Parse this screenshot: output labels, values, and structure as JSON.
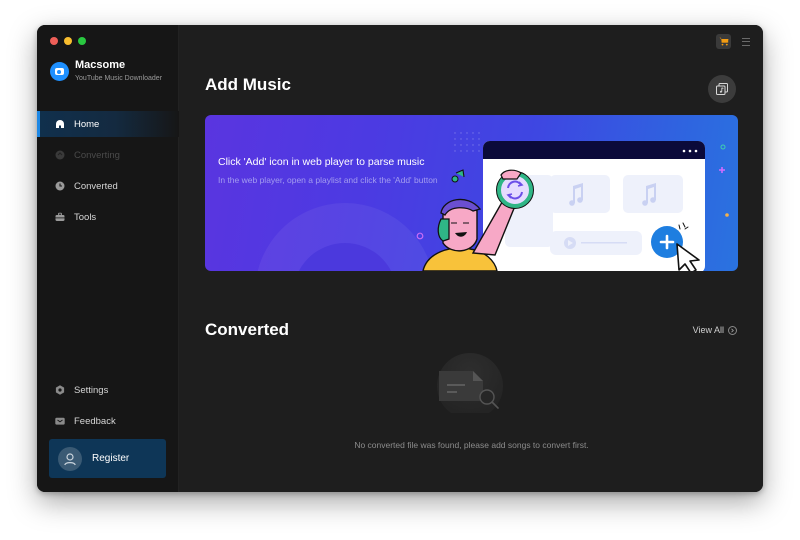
{
  "window": {
    "traffic_lights": [
      "close",
      "minimize",
      "zoom"
    ]
  },
  "brand": {
    "name": "Macsome",
    "subtitle": "YouTube Music Downloader",
    "logo_color": "#1e90ff"
  },
  "sidebar": {
    "items": [
      {
        "label": "Home",
        "icon": "home-icon",
        "state": "active"
      },
      {
        "label": "Converting",
        "icon": "converting-icon",
        "state": "disabled"
      },
      {
        "label": "Converted",
        "icon": "clock-icon",
        "state": "normal"
      },
      {
        "label": "Tools",
        "icon": "toolbox-icon",
        "state": "normal"
      }
    ],
    "bottom_items": [
      {
        "label": "Settings",
        "icon": "gear-icon"
      },
      {
        "label": "Feedback",
        "icon": "mail-icon"
      }
    ],
    "register": {
      "label": "Register",
      "icon": "user-icon"
    }
  },
  "topbar": {
    "icons": [
      "cart-icon",
      "menu-icon"
    ],
    "cart_color": "#f39c12"
  },
  "add_music": {
    "title": "Add Music",
    "add_button_icon": "music-library-icon",
    "banner": {
      "title": "Click 'Add' icon in web player to parse music",
      "subtitle": "In the web player, open a playlist and click the 'Add' button"
    }
  },
  "converted": {
    "title": "Converted",
    "view_all_label": "View All",
    "empty_message": "No converted file was found, please add songs to convert first."
  },
  "colors": {
    "accent": "#1e88e5",
    "sidebar_bg": "#161616",
    "main_bg": "#1e1e1e",
    "register_bg": "#0e3657"
  }
}
